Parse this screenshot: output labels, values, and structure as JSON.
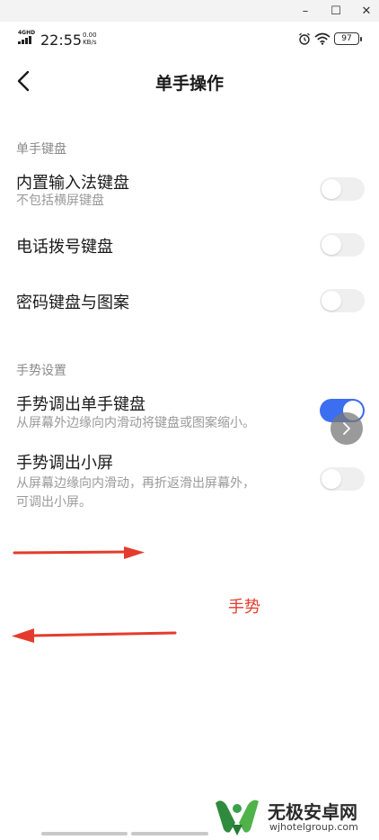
{
  "window": {
    "minimize": "–",
    "maximize": "☐",
    "close": "✕"
  },
  "status_bar": {
    "network_type": "4GHD",
    "time": "22:55",
    "speed_value": "0.00",
    "speed_unit": "KB/s",
    "battery": "97"
  },
  "header": {
    "title": "单手操作"
  },
  "sections": [
    {
      "label": "单手键盘",
      "items": [
        {
          "title": "内置输入法键盘",
          "subtitle": "不包括横屏键盘",
          "enabled": false
        },
        {
          "title": "电话拨号键盘",
          "enabled": false
        },
        {
          "title": "密码键盘与图案",
          "enabled": false
        }
      ]
    },
    {
      "label": "手势设置",
      "items": [
        {
          "title": "手势调出单手键盘",
          "subtitle": "从屏幕外边缘向内滑动将键盘或图案缩小。",
          "enabled": true
        },
        {
          "title": "手势调出小屏",
          "subtitle_lines": [
            "从屏幕边缘向内滑动，再折返滑出屏幕外，",
            "可调出小屏。"
          ],
          "enabled": false
        }
      ]
    }
  ],
  "annotation": {
    "label": "手势",
    "color": "#e53b2c"
  },
  "watermark": {
    "name": "无极安卓网",
    "url": "wjhotelgroup.com"
  },
  "colors": {
    "toggle_on": "#3c6ef2",
    "toggle_off": "#efefef",
    "annotation_red": "#e53b2c"
  }
}
